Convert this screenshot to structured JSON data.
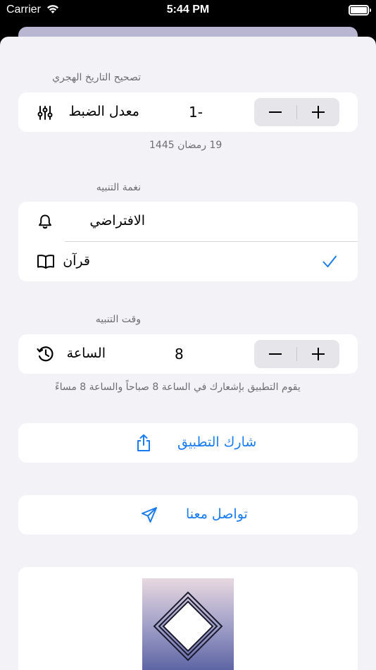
{
  "status_bar": {
    "carrier": "Carrier",
    "time": "5:44 PM",
    "battery_fill": 1.0
  },
  "hijri_section": {
    "label": "تصحيح التاريخ الهجري",
    "row_label": "معدل الضبط",
    "value": "1-",
    "date_text": "19 رمضان 1445",
    "icon": "sliders-icon"
  },
  "tone_section": {
    "label": "نغمة التنبيه",
    "options": [
      {
        "label": "الافتراضي",
        "icon": "bell-icon",
        "selected": false
      },
      {
        "label": "قرآن",
        "icon": "book-icon",
        "selected": true
      }
    ],
    "check_icon": "checkmark-icon"
  },
  "time_section": {
    "label": "وقت التنبيه",
    "row_label": "الساعة",
    "value": "8",
    "icon": "clock-history-icon",
    "note": "يقوم التطبيق بإشعارك في الساعة 8 صباحاً والساعة 8 مساءً"
  },
  "share": {
    "label": "شارك التطبيق",
    "icon": "share-icon"
  },
  "contact": {
    "label": "تواصل معنا",
    "icon": "paper-plane-icon"
  },
  "colors": {
    "accent": "#1a7cf2",
    "background": "#f2f2f7",
    "card": "#ffffff",
    "secondary_text": "#6d6d72"
  }
}
